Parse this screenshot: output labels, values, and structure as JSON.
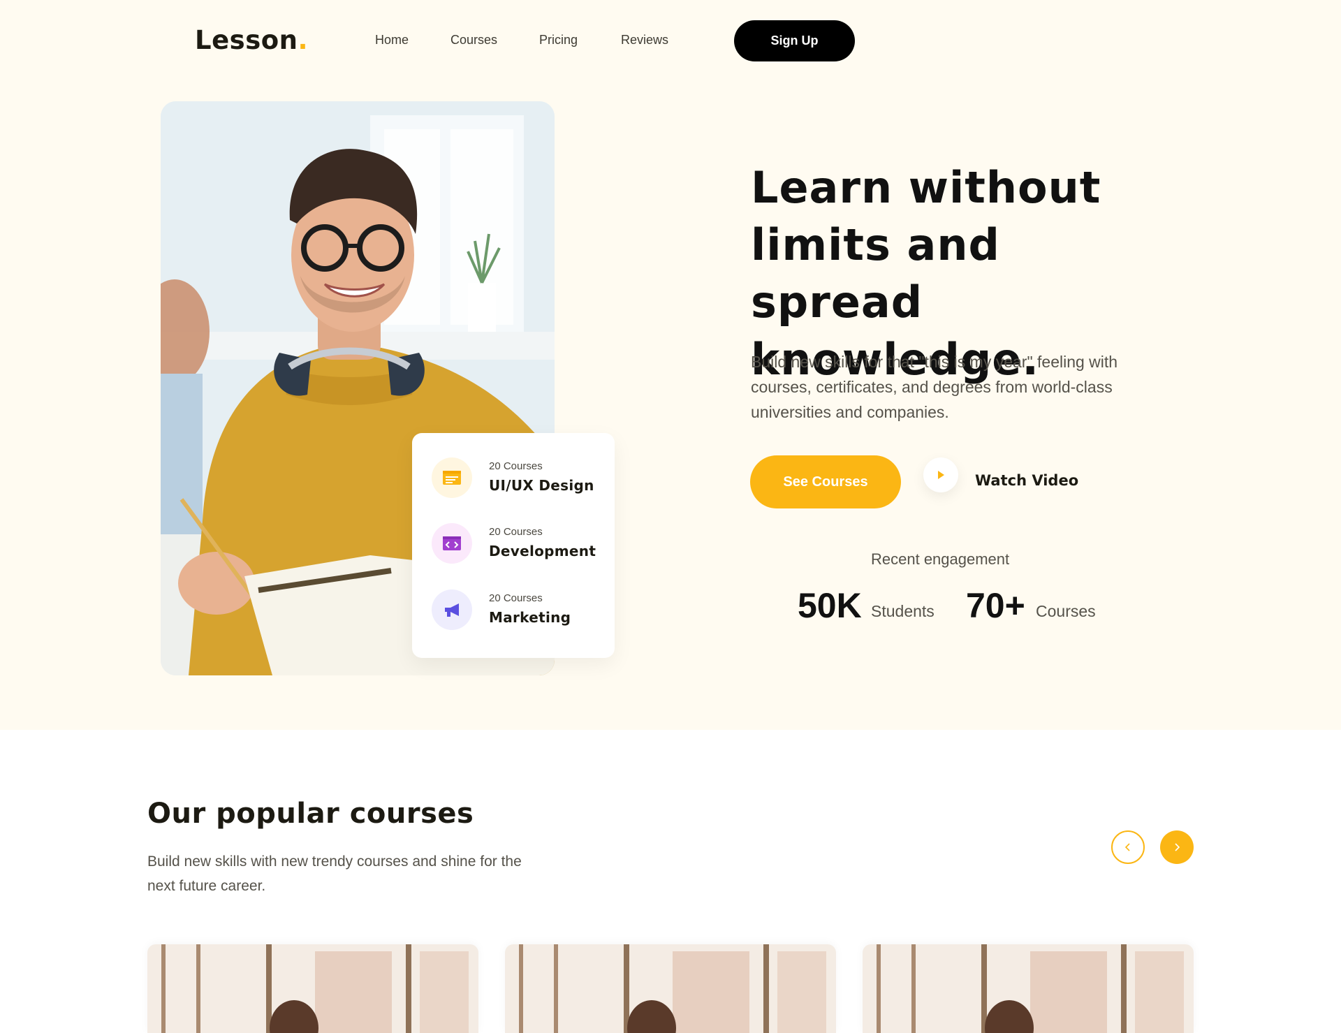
{
  "header": {
    "logo_text": "Lesson",
    "logo_dot": ".",
    "nav": [
      "Home",
      "Courses",
      "Pricing",
      "Reviews"
    ],
    "signup_label": "Sign Up"
  },
  "hero": {
    "headline": "Learn without limits and spread knowledge.",
    "subtext": "Build new skills for that \"this is my year\" feeling with courses, certificates, and degrees from world-class universities and companies.",
    "see_courses_label": "See Courses",
    "watch_video_label": "Watch Video",
    "engagement_label": "Recent engagement",
    "stats": [
      {
        "value": "50K",
        "label": "Students"
      },
      {
        "value": "70+",
        "label": "Courses"
      }
    ],
    "categories": [
      {
        "count": "20 Courses",
        "name": "UI/UX Design",
        "icon": "ui-ux-icon",
        "color": "#fbb614",
        "bg": "#fff6e0"
      },
      {
        "count": "20 Courses",
        "name": "Development",
        "icon": "code-window-icon",
        "color": "#a13fcf",
        "bg": "#fbe9fb"
      },
      {
        "count": "20 Courses",
        "name": "Marketing",
        "icon": "megaphone-icon",
        "color": "#5a4fe0",
        "bg": "#eeedfd"
      }
    ]
  },
  "popular": {
    "title": "Our popular courses",
    "subtitle": "Build new skills with new trendy courses and shine for the next future career.",
    "prev_icon": "chevron-left-icon",
    "next_icon": "chevron-right-icon"
  },
  "colors": {
    "accent": "#fbb614",
    "hero_bg": "#fffbf1",
    "dark": "#000000"
  }
}
